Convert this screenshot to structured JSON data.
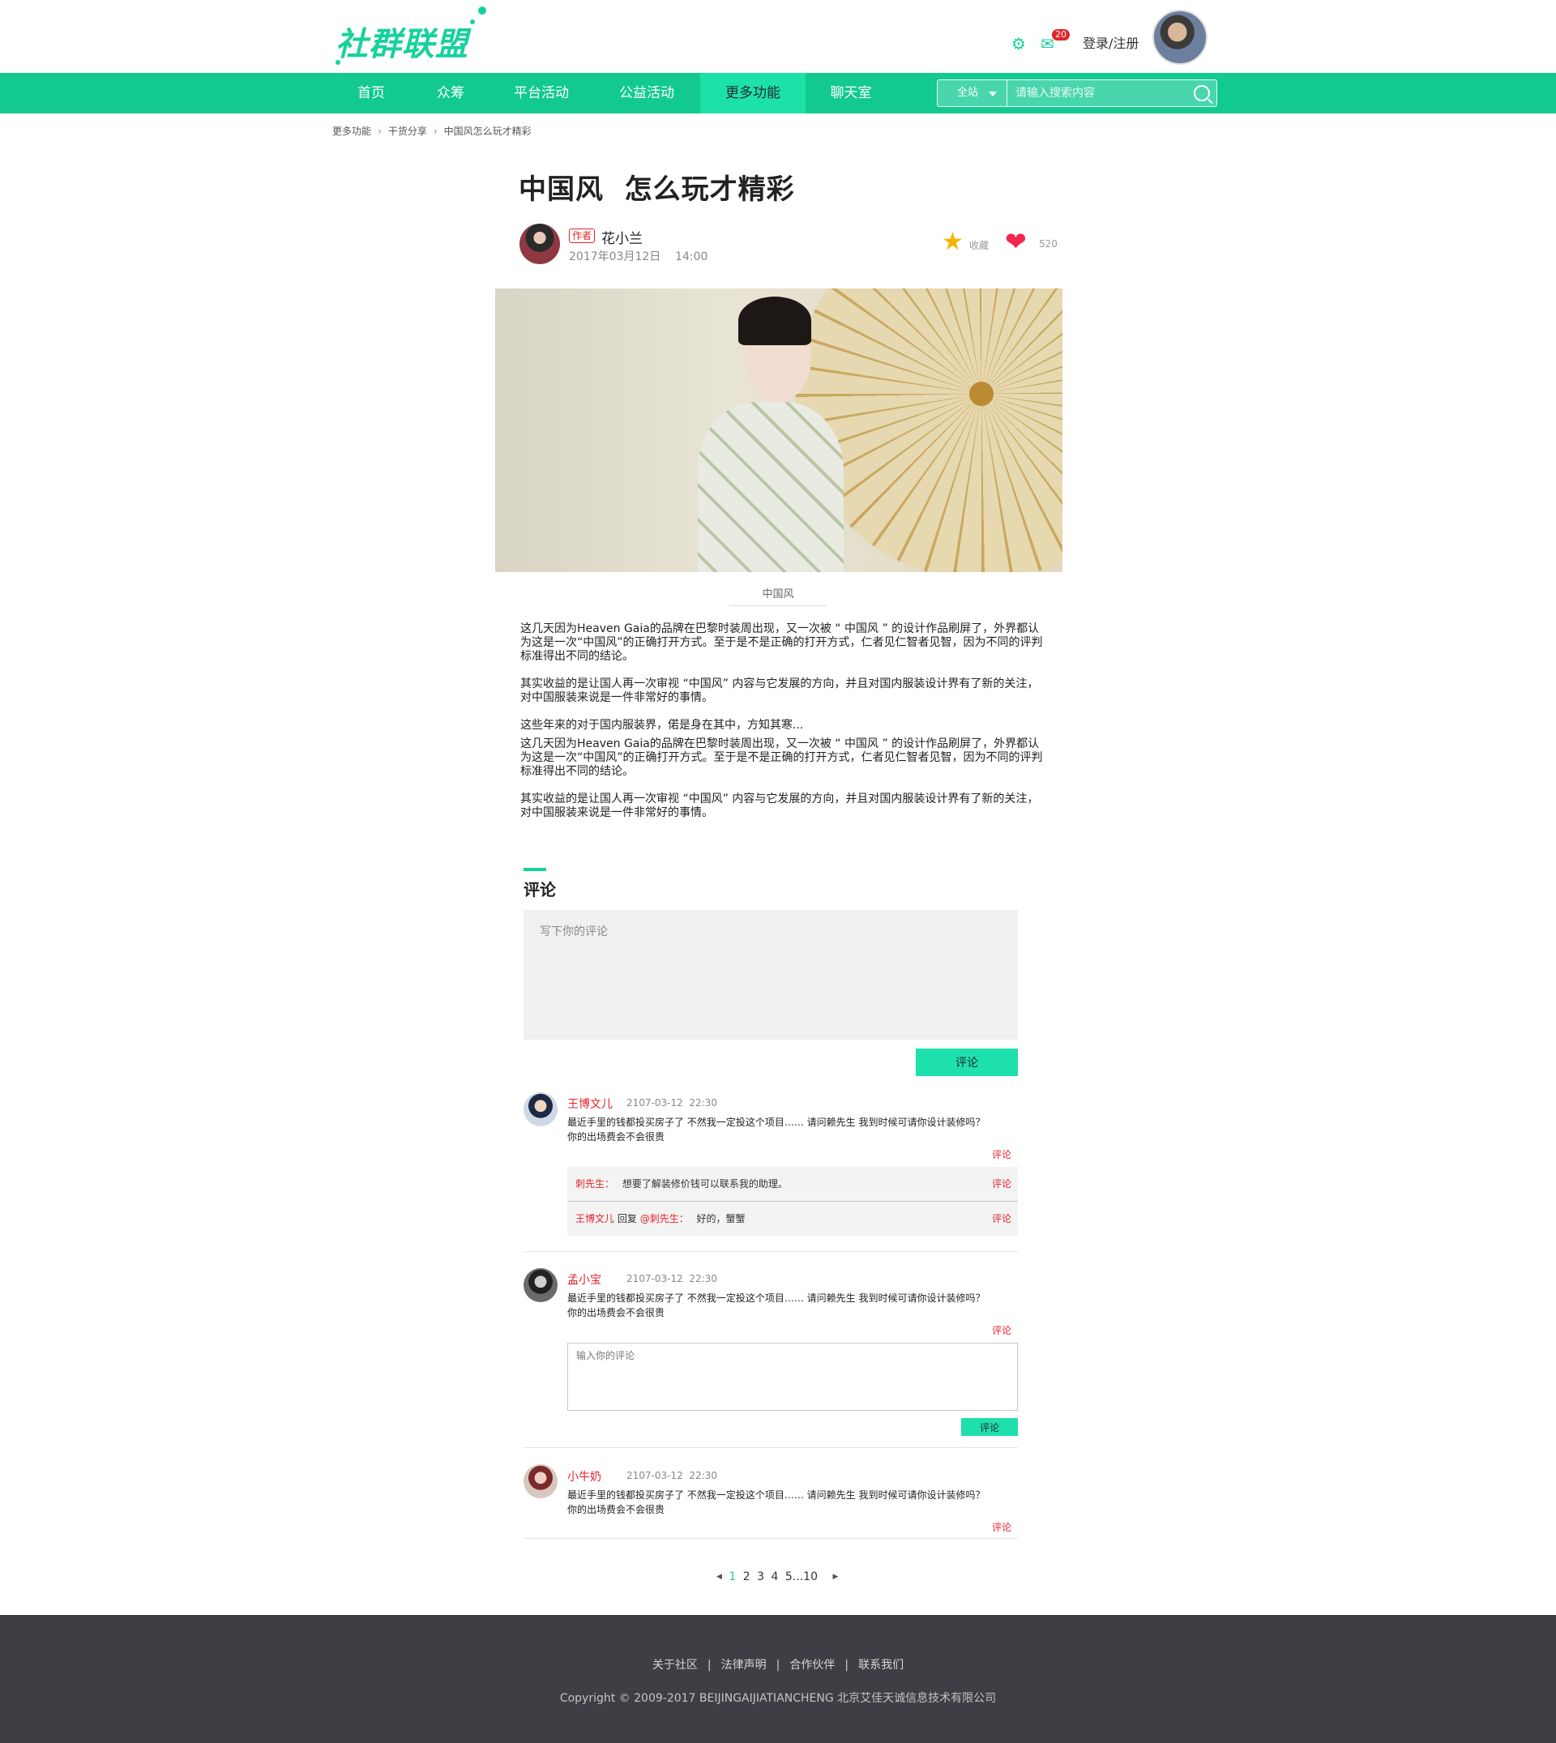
{
  "header": {
    "logo": "社群联盟",
    "settings_icon": "gear-icon",
    "mail_icon": "mail-icon",
    "mail_count": "20",
    "login_label": "登录/注册"
  },
  "nav": {
    "items": [
      "首页",
      "众筹",
      "平台活动",
      "公益活动",
      "更多功能",
      "聊天室"
    ],
    "active": "更多功能",
    "search_scope": "全站",
    "search_placeholder": "请输入搜索内容"
  },
  "breadcrumb": [
    "更多功能",
    "干货分享",
    "中国风怎么玩才精彩"
  ],
  "article": {
    "title": "中国风  怎么玩才精彩",
    "author_tag": "作者",
    "author": "花小兰",
    "time": "2017年03月12日    14:00",
    "fav_label": "收藏",
    "like_count": "520",
    "image_caption": "中国风",
    "paragraphs": [
      "这几天因为Heaven Gaia的品牌在巴黎时装周出现，又一次被 “  中国风 ” 的设计作品刷屏了，外界都认为这是一次“中国风”的正确打开方式。至于是不是正确的打开方式，仁者见仁智者见智，因为不同的评判标准得出不同的结论。",
      "其实收益的是让国人再一次审视 “中国风” 内容与它发展的方向，并且对国内服装设计界有了新的关注，对中国服装来说是一件非常好的事情。",
      "这些年来的对于国内服装界，偌是身在其中，方知其寒...",
      "这几天因为Heaven Gaia的品牌在巴黎时装周出现，又一次被 “  中国风 ” 的设计作品刷屏了，外界都认为这是一次“中国风”的正确打开方式。至于是不是正确的打开方式，仁者见仁智者见智，因为不同的评判标准得出不同的结论。",
      "其实收益的是让国人再一次审视 “中国风” 内容与它发展的方向，并且对国内服装设计界有了新的关注，对中国服装来说是一件非常好的事情。"
    ]
  },
  "comments": {
    "title": "评论",
    "placeholder": "写下你的评论",
    "submit": "评论",
    "reply_label": "评论",
    "items": [
      {
        "name": "王博文儿",
        "time": "2107-03-12  22:30",
        "text": "最近手里的钱都投买房子了 不然我一定投这个项目…… 请问赖先生 我到时候可请你设计装修吗？你的出场费会不会很贵"
      },
      {
        "name": "孟小宝",
        "time": "2107-03-12  22:30",
        "text": "最近手里的钱都投买房子了 不然我一定投这个项目…… 请问赖先生 我到时候可请你设计装修吗？你的出场费会不会很贵"
      },
      {
        "name": "小牛奶",
        "time": "2107-03-12  22:30",
        "text": "最近手里的钱都投买房子了 不然我一定投这个项目…… 请问赖先生 我到时候可请你设计装修吗？你的出场费会不会很贵"
      }
    ],
    "sub_replies": [
      {
        "name": "刺先生：",
        "text": "想要了解装修价钱可以联系我的助理。"
      },
      {
        "name": "王博文儿",
        "mid": "回复",
        "target": "@刺先生：",
        "text": "好的，蟹蟹"
      }
    ],
    "reply_placeholder": "输入你的评论",
    "reply_submit": "评论"
  },
  "pagination": {
    "pages": [
      "1",
      "2",
      "3",
      "4",
      "5"
    ],
    "ellipsis": "...",
    "last": "10",
    "current": "1"
  },
  "footer": {
    "links": [
      "关于社区",
      "法律声明",
      "合作伙伴",
      "联系我们"
    ],
    "copyright": "Copyright © 2009-2017 BEIJINGAIJIATIANCHENG 北京艾佳天诚信息技术有限公司"
  }
}
